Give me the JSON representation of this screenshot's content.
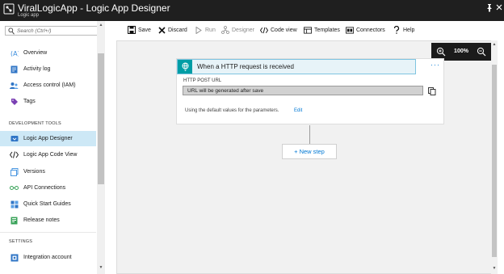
{
  "window": {
    "title": "ViralLogicApp - Logic App Designer",
    "subtitle": "Logic app",
    "pin_icon": "pin-icon",
    "close_icon": "close-icon"
  },
  "sidebar": {
    "search": {
      "placeholder": "Search (Ctrl+/)",
      "value": ""
    },
    "items": [
      {
        "label": "Overview",
        "icon": "overview-icon"
      },
      {
        "label": "Activity log",
        "icon": "activity-log-icon"
      },
      {
        "label": "Access control (IAM)",
        "icon": "access-control-icon"
      },
      {
        "label": "Tags",
        "icon": "tag-icon"
      }
    ],
    "section_dev": "DEVELOPMENT TOOLS",
    "dev_items": [
      {
        "label": "Logic App Designer",
        "icon": "designer-icon",
        "active": true
      },
      {
        "label": "Logic App Code View",
        "icon": "code-view-icon"
      },
      {
        "label": "Versions",
        "icon": "versions-icon"
      },
      {
        "label": "API Connections",
        "icon": "api-connections-icon"
      },
      {
        "label": "Quick Start Guides",
        "icon": "quick-start-icon"
      },
      {
        "label": "Release notes",
        "icon": "release-notes-icon"
      }
    ],
    "section_settings": "SETTINGS",
    "settings_items": [
      {
        "label": "Integration account",
        "icon": "integration-account-icon"
      }
    ]
  },
  "toolbar": {
    "save": "Save",
    "discard": "Discard",
    "run": "Run",
    "designer": "Designer",
    "code_view": "Code view",
    "templates": "Templates",
    "connectors": "Connectors",
    "help": "Help"
  },
  "zoom": {
    "value": "100%"
  },
  "trigger_card": {
    "title": "When a HTTP request is received",
    "more": "···",
    "url_label": "HTTP POST URL",
    "url_value": "URL will be generated after save",
    "hint": "Using the default values for the parameters.",
    "edit": "Edit"
  },
  "new_step": "+ New step",
  "colors": {
    "titlebar": "#1f1f1f",
    "accent": "#0078d4",
    "trigger_icon": "#009da5",
    "active_nav": "#cde8f6"
  }
}
